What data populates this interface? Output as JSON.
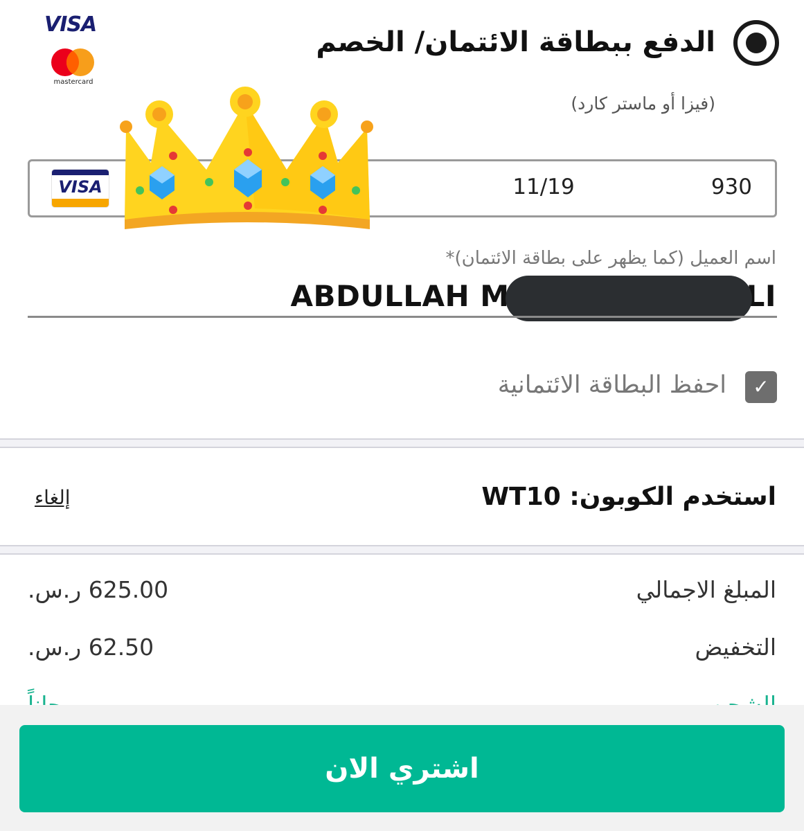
{
  "payment_method": {
    "title": "الدفع ببطاقة الائتمان/ الخصم",
    "subtitle": "(فيزا أو ماستر كارد)",
    "selected": true
  },
  "brands": {
    "visa": "VISA",
    "mastercard": "mastercard"
  },
  "card": {
    "network": "VISA",
    "expiry": "11/19",
    "cvv": "930"
  },
  "customer": {
    "label": "اسم العميل (كما يظهر على بطاقة الائتمان)*",
    "name_prefix": "ABDULLAH M",
    "name_suffix": "LI"
  },
  "save_card": {
    "label": "احفظ البطاقة الائتمانية",
    "checked": true
  },
  "coupon": {
    "label": "استخدم الكوبون: WT10",
    "cancel": "إلغاء"
  },
  "summary": {
    "total_label": "المبلغ الاجمالي",
    "total_value": "625.00 ر.س.",
    "discount_label": "التخفيض",
    "discount_value": "62.50 ر.س.",
    "shipping_label": "الشحن",
    "shipping_value": "مجاناً"
  },
  "buy_button": "اشتري الان",
  "colors": {
    "accent": "#00b894",
    "redaction": "#2b2e31"
  }
}
